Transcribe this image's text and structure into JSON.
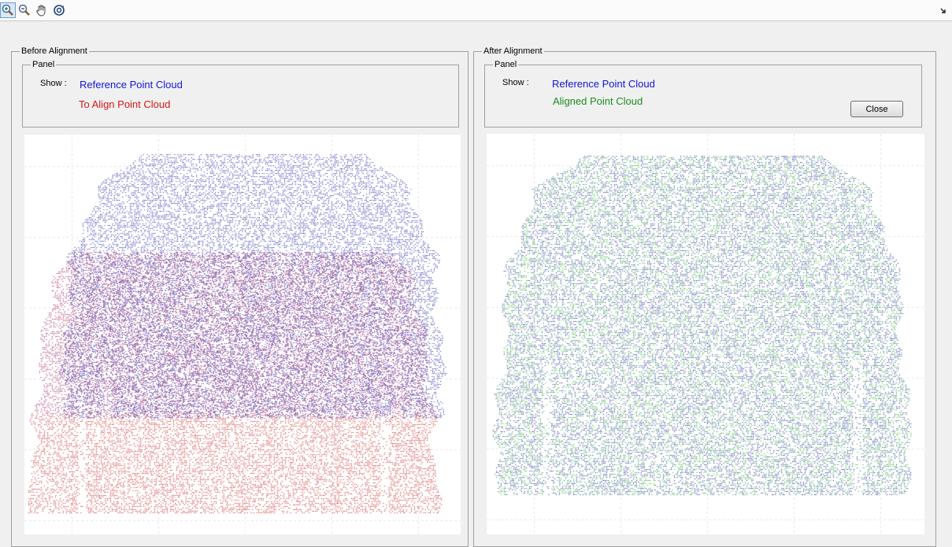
{
  "toolbar": {
    "tools": [
      {
        "name": "zoom-in-icon",
        "active": true
      },
      {
        "name": "zoom-out-icon",
        "active": false
      },
      {
        "name": "pan-hand-icon",
        "active": false
      },
      {
        "name": "rotate-3d-icon",
        "active": false
      }
    ],
    "dock_icon": "dock-arrow-icon"
  },
  "before": {
    "title": "Before Alignment",
    "panel_title": "Panel",
    "show_label": "Show :",
    "legend": [
      {
        "label": "Reference Point Cloud",
        "color": "#1515d6"
      },
      {
        "label": "To Align Point Cloud",
        "color": "#d21818"
      }
    ]
  },
  "after": {
    "title": "After Alignment",
    "panel_title": "Panel",
    "show_label": "Show :",
    "legend": [
      {
        "label": "Reference Point Cloud",
        "color": "#1515d6"
      },
      {
        "label": "Aligned Point Cloud",
        "color": "#1d8b1d"
      }
    ],
    "close_label": "Close"
  },
  "colors": {
    "reference": "#1a1aa0",
    "to_align": "#c81e1e",
    "aligned": "#22b022"
  }
}
